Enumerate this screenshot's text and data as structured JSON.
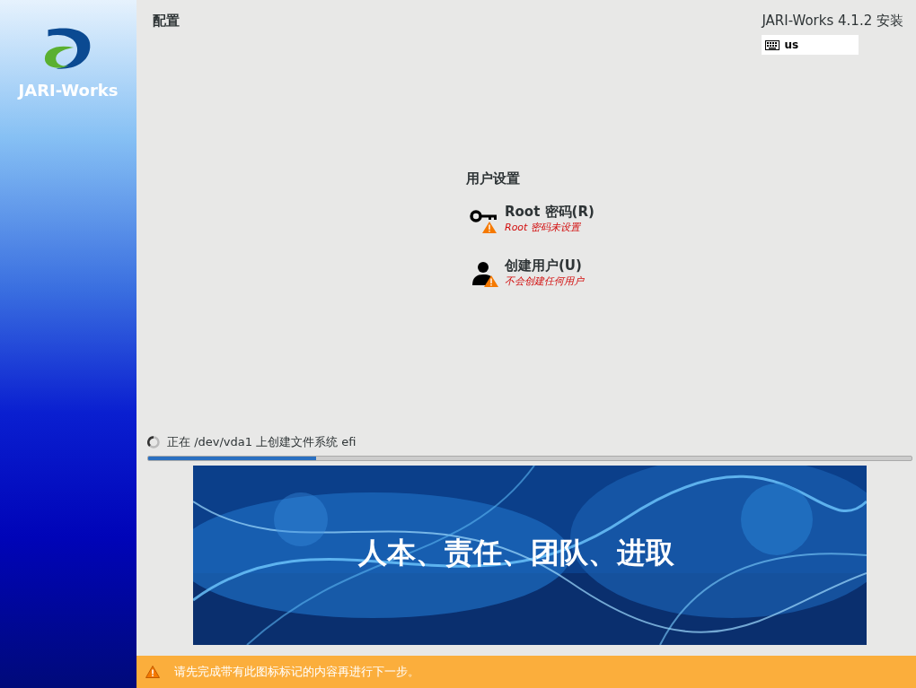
{
  "sidebar": {
    "logo_text": "JARI-Works"
  },
  "header": {
    "title": "配置",
    "product": "JARI-Works 4.1.2 安装",
    "keyboard_layout": "us"
  },
  "hub": {
    "heading": "用户设置",
    "spokes": [
      {
        "kind": "key",
        "title": "Root 密码(R)",
        "status": "Root 密码未设置",
        "warning": true
      },
      {
        "kind": "user",
        "title": "创建用户(U)",
        "status": "不会创建任何用户",
        "warning": true
      }
    ]
  },
  "progress": {
    "message": "正在 /dev/vda1 上创建文件系统 efi",
    "level": 0.22
  },
  "banner": {
    "kind": "picture",
    "caption": "人本、责任、团队、进取"
  },
  "warning_bar": {
    "message": "请先完成带有此图标标记的内容再进行下一步。"
  }
}
